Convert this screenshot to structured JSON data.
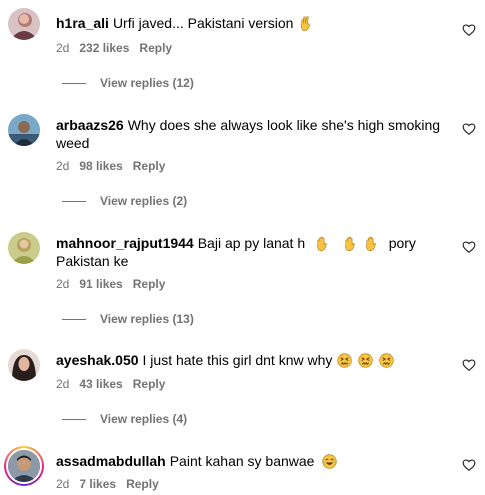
{
  "comments": [
    {
      "username": "h1ra_ali",
      "text": "Urfi javed... Pakistani version",
      "emoji": "✌️",
      "time": "2d",
      "likes": "232 likes",
      "reply": "Reply",
      "view_replies": "View replies (12)"
    },
    {
      "username": "arbaazs26",
      "text": "Why does she always look like she's high smoking weed",
      "time": "2d",
      "likes": "98 likes",
      "reply": "Reply",
      "view_replies": "View replies (2)"
    },
    {
      "username": "mahnoor_rajput1944",
      "text_before": "Baji ap py lanat h",
      "emojis": [
        "🖐️",
        "🖐️",
        "🖐️"
      ],
      "text_after": "pory Pakistan ke",
      "time": "2d",
      "likes": "91 likes",
      "reply": "Reply",
      "view_replies": "View replies (13)"
    },
    {
      "username": "ayeshak.050",
      "text": "I just hate this girl dnt knw why",
      "emojis": [
        "😖",
        "😖",
        "😖"
      ],
      "time": "2d",
      "likes": "43 likes",
      "reply": "Reply",
      "view_replies": "View replies (4)"
    },
    {
      "username": "assadmabdullah",
      "text": "Paint kahan sy banwae",
      "emoji": "😂",
      "time": "2d",
      "likes": "7 likes",
      "reply": "Reply"
    }
  ],
  "icons": {
    "like": "heart-outline-icon"
  },
  "colors": {
    "secondary_text": "#737373",
    "story_ring": "#ee2a7b"
  }
}
